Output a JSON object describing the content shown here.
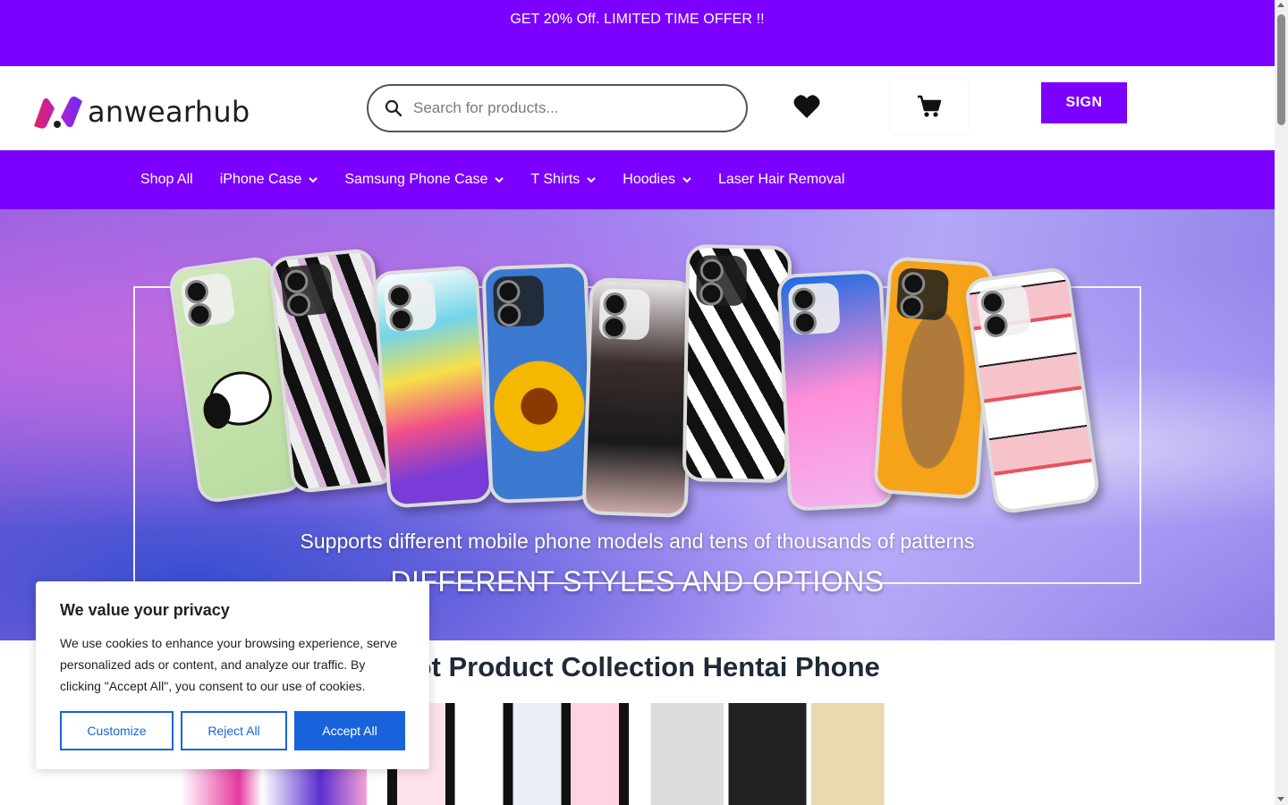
{
  "promo": {
    "text": "GET 20% Off. LIMITED TIME OFFER !!"
  },
  "header": {
    "logo_text": "anwearhub",
    "search_placeholder": "Search for products...",
    "sign_label": "SIGN"
  },
  "nav": {
    "items": [
      {
        "label": "Shop All",
        "dropdown": false
      },
      {
        "label": "iPhone Case",
        "dropdown": true
      },
      {
        "label": "Samsung Phone Case",
        "dropdown": true
      },
      {
        "label": "T Shirts",
        "dropdown": true
      },
      {
        "label": "Hoodies",
        "dropdown": true
      },
      {
        "label": "Laser Hair Removal",
        "dropdown": false
      }
    ]
  },
  "hero": {
    "subtitle": "Supports different mobile phone models and tens of thousands of patterns",
    "title": "DIFFERENT STYLES AND OPTIONS"
  },
  "section": {
    "title": "Hot Product Collection Hentai Phone"
  },
  "cookie": {
    "title": "We value your privacy",
    "text": "We use cookies to enhance your browsing experience, serve personalized ads or content, and analyze our traffic. By clicking \"Accept All\", you consent to our use of cookies.",
    "customize": "Customize",
    "reject": "Reject All",
    "accept": "Accept All"
  },
  "colors": {
    "brand_purple": "#7c00ff",
    "cookie_blue": "#1863dc",
    "heading_dark": "#1f2937"
  },
  "icons": {
    "search": "search-icon",
    "wishlist": "heart-icon",
    "cart": "cart-icon",
    "dropdown": "chevron-down-icon"
  }
}
